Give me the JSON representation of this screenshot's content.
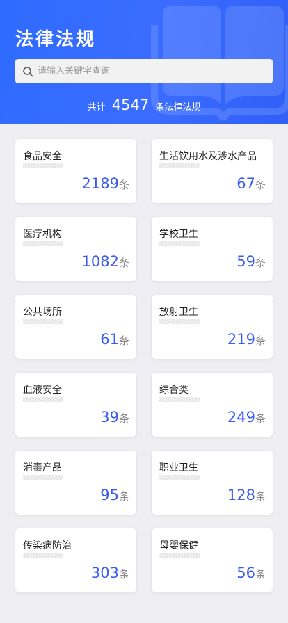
{
  "header": {
    "title": "法律法规",
    "search_placeholder": "请输入关键字查询",
    "total_prefix": "共计",
    "total_count": "4547",
    "total_suffix": "条法律法规"
  },
  "unit": "条",
  "categories": [
    {
      "name": "食品安全",
      "count": "2189"
    },
    {
      "name": "生活饮用水及涉水产品",
      "count": "67"
    },
    {
      "name": "医疗机构",
      "count": "1082"
    },
    {
      "name": "学校卫生",
      "count": "59"
    },
    {
      "name": "公共场所",
      "count": "61"
    },
    {
      "name": "放射卫生",
      "count": "219"
    },
    {
      "name": "血液安全",
      "count": "39"
    },
    {
      "name": "综合类",
      "count": "249"
    },
    {
      "name": "消毒产品",
      "count": "95"
    },
    {
      "name": "职业卫生",
      "count": "128"
    },
    {
      "name": "传染病防治",
      "count": "303"
    },
    {
      "name": "母婴保健",
      "count": "56"
    }
  ],
  "colors": {
    "header_blue": "#3b6cff",
    "count_blue": "#3a5bf0",
    "background": "#efeff3"
  },
  "icons": {
    "search": "search-icon",
    "decoration": "book-icon"
  }
}
